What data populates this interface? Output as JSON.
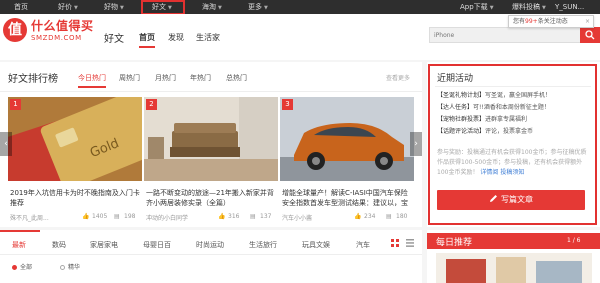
{
  "topnav": {
    "items": [
      "首页",
      "好价",
      "好物",
      "好文",
      "海淘",
      "更多"
    ],
    "app": "App下载",
    "report": "爆料投稿",
    "user": "Y_SUN..."
  },
  "brand": {
    "logo_mark": "值",
    "name_cn": "什么值得买",
    "name_en": "SMZDM.COM"
  },
  "header": {
    "section": "好文",
    "nav": [
      "首页",
      "发现",
      "生活家"
    ],
    "search_placeholder": "iPhone",
    "notify_prefix": "您有",
    "notify_count": "99+",
    "notify_suffix": "条关注动态",
    "notify_close": "×"
  },
  "ranking": {
    "title": "好文排行榜",
    "tabs": [
      "今日热门",
      "周热门",
      "月热门",
      "年热门",
      "总热门"
    ],
    "more": "查看更多",
    "arrow_left": "‹",
    "arrow_right": "›",
    "cards": [
      {
        "rank": "1",
        "title": "2019年入坑信用卡为时不晚指南及入门卡推荐",
        "author": "殊不凡_此周...",
        "likes": "1405",
        "comments": "198"
      },
      {
        "rank": "2",
        "title": "一路不断变动的旅途—21年搬入新家并背齐小两居装修实录（全篇）",
        "author": "冲动的小白同学",
        "likes": "316",
        "comments": "137"
      },
      {
        "rank": "3",
        "title": "增能全球量产！解读C-IASI中国汽车保险安全指数首发车型测试结果：建议以，宝",
        "author": "汽车小小酱",
        "likes": "234",
        "comments": "180"
      }
    ]
  },
  "categories": {
    "items": [
      "最新",
      "数码",
      "家居家电",
      "母婴日百",
      "时尚运动",
      "生活旅行",
      "玩具文娱",
      "汽车"
    ],
    "filters": [
      "全部",
      "精华"
    ]
  },
  "activity": {
    "title": "近期活动",
    "items": [
      {
        "tag": "【圣诞礼物计划】",
        "text": "写圣诞，赢全国屏手机！"
      },
      {
        "tag": "【达人任务】",
        "text": "可!!酒香和本周份新征主题！"
      },
      {
        "tag": "【宠物社群投票】",
        "text": "进群拿专属福利"
      },
      {
        "tag": "【话题评论活动】",
        "text": "评论，投票拿金币"
      }
    ],
    "note_text": "参与奖励：投稿通过有机会获得100金币；参与征稿优质作品获得100-500金币；参与投稿，还有机会获得额外100金币奖励！",
    "note_link1": "详情阅",
    "note_link2": "投稿须知",
    "button": "写篇文章"
  },
  "daily": {
    "title": "每日推荐",
    "page": "1 / 6"
  },
  "colors": {
    "brand_red": "#e53935",
    "highlight_box": "#e23130",
    "nav_bg": "#2e2e2e"
  }
}
